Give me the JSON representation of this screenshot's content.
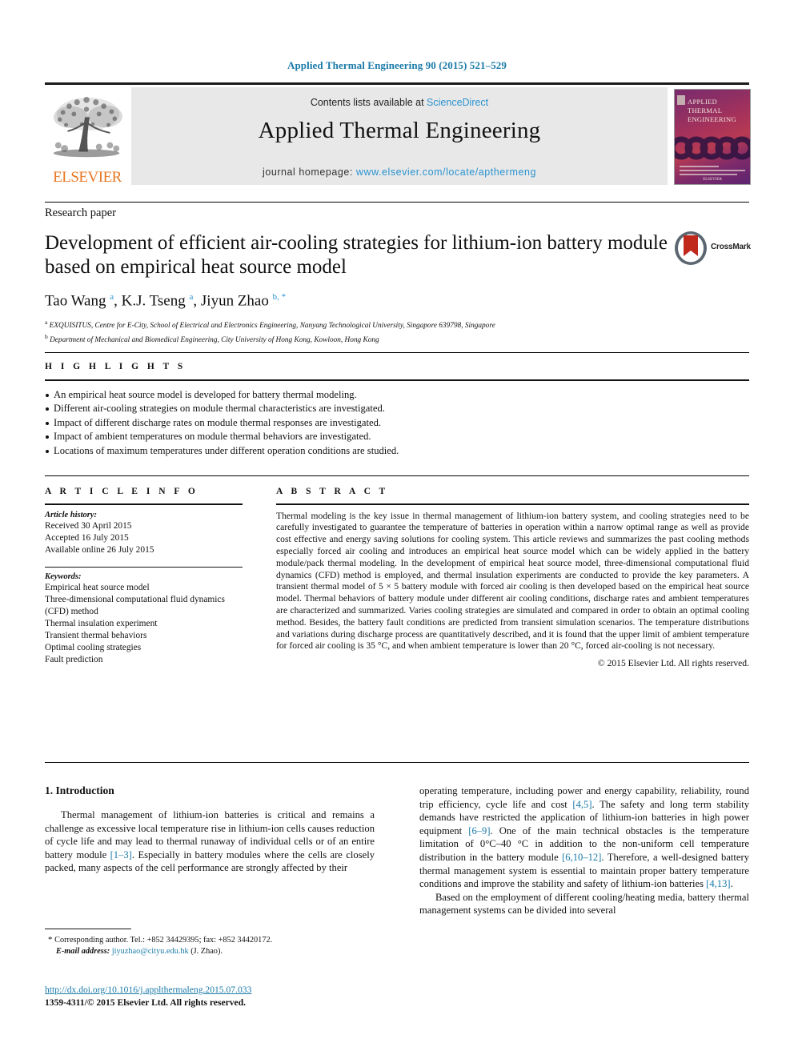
{
  "running_head": "Applied Thermal Engineering 90 (2015) 521–529",
  "masthead": {
    "contents_prefix": "Contents lists available at ",
    "sciencedirect": "ScienceDirect",
    "journal_title": "Applied Thermal Engineering",
    "homepage_prefix": "journal homepage: ",
    "homepage_url": "www.elsevier.com/locate/apthermeng",
    "publisher_logo_text": "ELSEVIER",
    "cover_title": "APPLIED THERMAL ENGINEERING",
    "colors": {
      "link_blue": "#2a93d0",
      "elsevier_orange": "#E87722",
      "panel_gray": "#e8e8e8"
    }
  },
  "article": {
    "type": "Research paper",
    "title": "Development of efficient air-cooling strategies for lithium-ion battery module based on empirical heat source model",
    "authors_html": "Tao Wang <sup>a</sup>, K.J. Tseng <sup>a</sup>, Jiyun Zhao <sup>b, *</sup>",
    "affiliation_a": "EXQUISITUS, Centre for E-City, School of Electrical and Electronics Engineering, Nanyang Technological University, Singapore 639798, Singapore",
    "affiliation_b": "Department of Mechanical and Biomedical Engineering, City University of Hong Kong, Kowloon, Hong Kong",
    "crossmark_label": "CrossMark"
  },
  "highlights": {
    "heading": "H I G H L I G H T S",
    "items": [
      "An empirical heat source model is developed for battery thermal modeling.",
      "Different air-cooling strategies on module thermal characteristics are investigated.",
      "Impact of different discharge rates on module thermal responses are investigated.",
      "Impact of ambient temperatures on module thermal behaviors are investigated.",
      "Locations of maximum temperatures under different operation conditions are studied."
    ]
  },
  "article_info": {
    "heading": "A R T I C L E   I N F O",
    "history_label": "Article history:",
    "history": [
      "Received 30 April 2015",
      "Accepted 16 July 2015",
      "Available online 26 July 2015"
    ],
    "keywords_label": "Keywords:",
    "keywords": [
      "Empirical heat source model",
      "Three-dimensional computational fluid dynamics (CFD) method",
      "Thermal insulation experiment",
      "Transient thermal behaviors",
      "Optimal cooling strategies",
      "Fault prediction"
    ]
  },
  "abstract": {
    "heading": "A B S T R A C T",
    "text": "Thermal modeling is the key issue in thermal management of lithium-ion battery system, and cooling strategies need to be carefully investigated to guarantee the temperature of batteries in operation within a narrow optimal range as well as provide cost effective and energy saving solutions for cooling system. This article reviews and summarizes the past cooling methods especially forced air cooling and introduces an empirical heat source model which can be widely applied in the battery module/pack thermal modeling. In the development of empirical heat source model, three-dimensional computational fluid dynamics (CFD) method is employed, and thermal insulation experiments are conducted to provide the key parameters. A transient thermal model of 5 × 5 battery module with forced air cooling is then developed based on the empirical heat source model. Thermal behaviors of battery module under different air cooling conditions, discharge rates and ambient temperatures are characterized and summarized. Varies cooling strategies are simulated and compared in order to obtain an optimal cooling method. Besides, the battery fault conditions are predicted from transient simulation scenarios. The temperature distributions and variations during discharge process are quantitatively described, and it is found that the upper limit of ambient temperature for forced air cooling is 35 °C, and when ambient temperature is lower than 20 °C, forced air-cooling is not necessary.",
    "copyright": "© 2015 Elsevier Ltd. All rights reserved."
  },
  "body": {
    "section_heading": "1. Introduction",
    "left_para_1_pre": "Thermal management of lithium-ion batteries is critical and remains a challenge as excessive local temperature rise in lithium-ion cells causes reduction of cycle life and may lead to thermal runaway of individual cells or of an entire battery module ",
    "left_ref_1": "[1–3]",
    "left_para_1_post": ". Especially in battery modules where the cells are closely packed, many aspects of the cell performance are strongly affected by their",
    "right_para_1_a": "operating temperature, including power and energy capability, reliability, round trip efficiency, cycle life and cost ",
    "right_ref_1": "[4,5]",
    "right_para_1_b": ". The safety and long term stability demands have restricted the application of lithium-ion batteries in high power equipment ",
    "right_ref_2": "[6–9]",
    "right_para_1_c": ". One of the main technical obstacles is the temperature limitation of 0°C–40 °C in addition to the non-uniform cell temperature distribution in the battery module ",
    "right_ref_3": "[6,10–12]",
    "right_para_1_d": ". Therefore, a well-designed battery thermal management system is essential to maintain proper battery temperature conditions and improve the stability and safety of lithium-ion batteries ",
    "right_ref_4": "[4,13]",
    "right_para_1_e": ".",
    "right_para_2": "Based on the employment of different cooling/heating media, battery thermal management systems can be divided into several"
  },
  "footnote": {
    "star": "*",
    "corresponding": "Corresponding author. Tel.: +852 34429395; fax: +852 34420172.",
    "email_label": "E-mail address:",
    "email": "jiyuzhao@cityu.edu.hk",
    "email_suffix": "(J. Zhao).",
    "doi": "http://dx.doi.org/10.1016/j.applthermaleng.2015.07.033",
    "issn_line": "1359-4311/© 2015 Elsevier Ltd. All rights reserved."
  }
}
